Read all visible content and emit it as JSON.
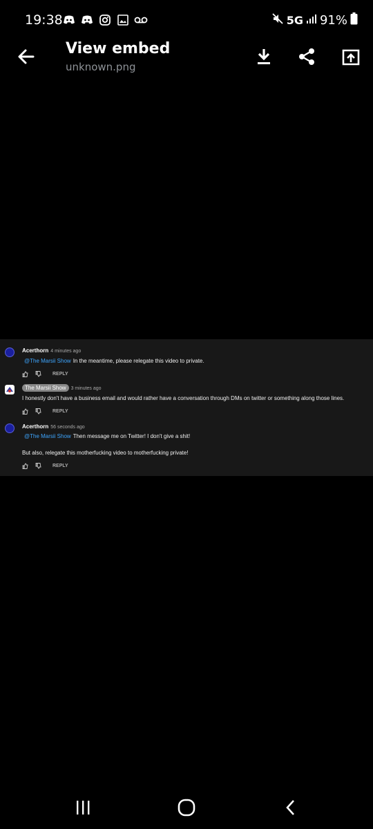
{
  "status_bar": {
    "time": "19:38",
    "network": "5G",
    "battery": "91%",
    "left_icons": [
      "discord-icon",
      "discord-icon",
      "instagram-icon",
      "image-icon",
      "voicemail-icon"
    ],
    "right_icons": [
      "mute-icon",
      "signal-icon",
      "battery-icon"
    ]
  },
  "app_bar": {
    "title": "View embed",
    "subtitle": "unknown.png",
    "actions": [
      "download-icon",
      "share-icon",
      "open-external-icon"
    ]
  },
  "embed": {
    "comments": [
      {
        "author": "Acerthorn",
        "timestamp": "4 minutes ago",
        "mention": "@The Marsii Show",
        "text": "In the meantime, please relegate this video to private.",
        "reply_label": "REPLY"
      },
      {
        "author": "The Marsii Show",
        "timestamp": "3 minutes ago",
        "text": "I honestly don't have a business email and would rather have a conversation through DMs on twitter or something along those lines.",
        "reply_label": "REPLY"
      },
      {
        "author": "Acerthorn",
        "timestamp": "56 seconds ago",
        "mention": "@The Marsii Show",
        "text": "Then message me on Twitter! I don't give a shit!",
        "text2": "But also, relegate this motherfucking video to motherfucking private!",
        "reply_label": "REPLY"
      }
    ]
  },
  "nav_bar": {
    "buttons": [
      "recent-apps-icon",
      "home-icon",
      "back-icon"
    ]
  }
}
